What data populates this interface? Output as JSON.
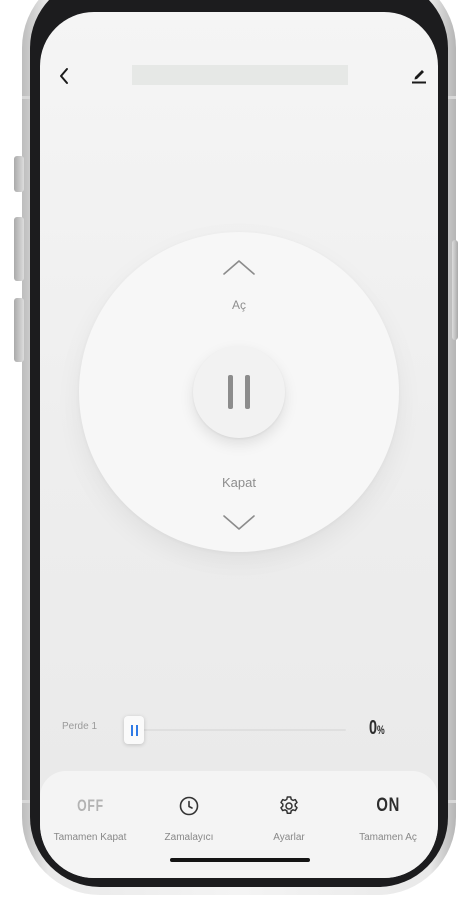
{
  "header": {
    "back_icon": "chevron-left-icon",
    "edit_icon": "pencil-icon",
    "title": ""
  },
  "control": {
    "open_label": "Aç",
    "close_label": "Kapat",
    "up_icon": "chevron-up-icon",
    "down_icon": "chevron-down-icon",
    "pause_icon": "pause-icon"
  },
  "slider": {
    "label": "Perde 1",
    "value_number": "0",
    "value_unit": "%",
    "position_fraction": 0.0,
    "accent_color": "#2f7ae5"
  },
  "bottom_bar": {
    "tabs": [
      {
        "top_text": "OFF",
        "label": "Tamamen Kapat"
      },
      {
        "icon": "clock-icon",
        "label": "Zamalayıcı"
      },
      {
        "icon": "gear-icon",
        "label": "Ayarlar"
      },
      {
        "top_text": "ON",
        "label": "Tamamen Aç"
      }
    ]
  }
}
